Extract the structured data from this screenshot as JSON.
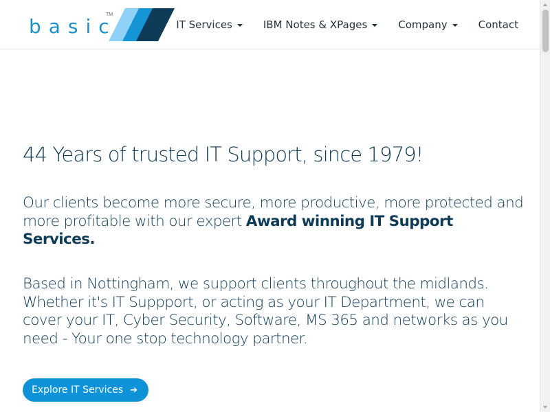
{
  "brand": {
    "wordmark": "basic",
    "trademark": "TM"
  },
  "colors": {
    "brand_blue": "#1c8fcc",
    "brand_navy": "#0e3b57",
    "button_blue": "#0e93d8",
    "logo_light": "#8fd1f7",
    "logo_mid": "#1695d6"
  },
  "nav": {
    "items": [
      {
        "label": "IT Services",
        "dropdown": true
      },
      {
        "label": "IBM Notes & XPages",
        "dropdown": true
      },
      {
        "label": "Company",
        "dropdown": true
      },
      {
        "label": "Contact",
        "dropdown": false
      }
    ]
  },
  "hero": {
    "title": "44 Years of trusted IT Support, since 1979!",
    "lead_text": "Our clients become more secure, more productive, more protected and more profitable with our expert",
    "lead_emphasis": "Award winning IT Support Services.",
    "body": "Based in Nottingham, we support clients throughout the midlands. Whether it's IT Suppport, or acting as your IT Department, we can cover your IT, Cyber Security, Software, MS 365 and networks as you need - Your one stop technology partner.",
    "cta_label": "Explore IT Services",
    "cta_icon": "arrow-right-icon"
  }
}
